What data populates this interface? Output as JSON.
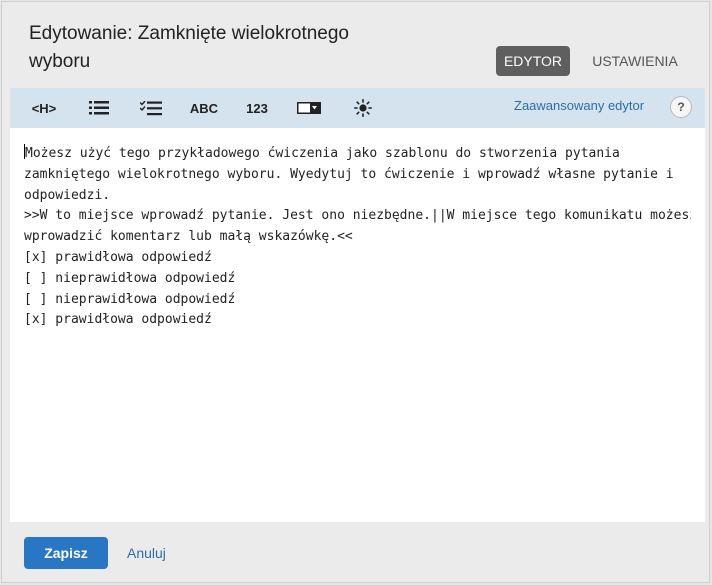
{
  "dialog": {
    "title": "Edytowanie: Zamknięte wielokrotnego wyboru",
    "tabs": {
      "editor": "EDYTOR",
      "settings": "USTAWIENIA"
    }
  },
  "toolbar": {
    "heading_label": "<H>",
    "abc_label": "ABC",
    "number_label": "123",
    "advanced_editor": "Zaawansowany edytor",
    "help": "?",
    "icons": [
      "heading-icon",
      "bulleted-list-icon",
      "checklist-icon",
      "abc-icon",
      "number-icon",
      "dropdown-icon",
      "brightness-icon",
      "help-icon"
    ]
  },
  "editor": {
    "lines": [
      "Możesz użyć tego przykładowego ćwiczenia jako szablonu do stworzenia pytania",
      "zamkniętego wielokrotnego wyboru. Wyedytuj to ćwiczenie i wprowadź własne pytanie i",
      "odpowiedzi.",
      ">>W to miejsce wprowadź pytanie. Jest ono niezbędne.||W miejsce tego komunikatu możesz",
      "wprowadzić komentarz lub małą wskazówkę.<<",
      "[x] prawidłowa odpowiedź",
      "[ ] nieprawidłowa odpowiedź",
      "[ ] nieprawidłowa odpowiedź",
      "[x] prawidłowa odpowiedź"
    ]
  },
  "footer": {
    "save": "Zapisz",
    "cancel": "Anuluj"
  }
}
